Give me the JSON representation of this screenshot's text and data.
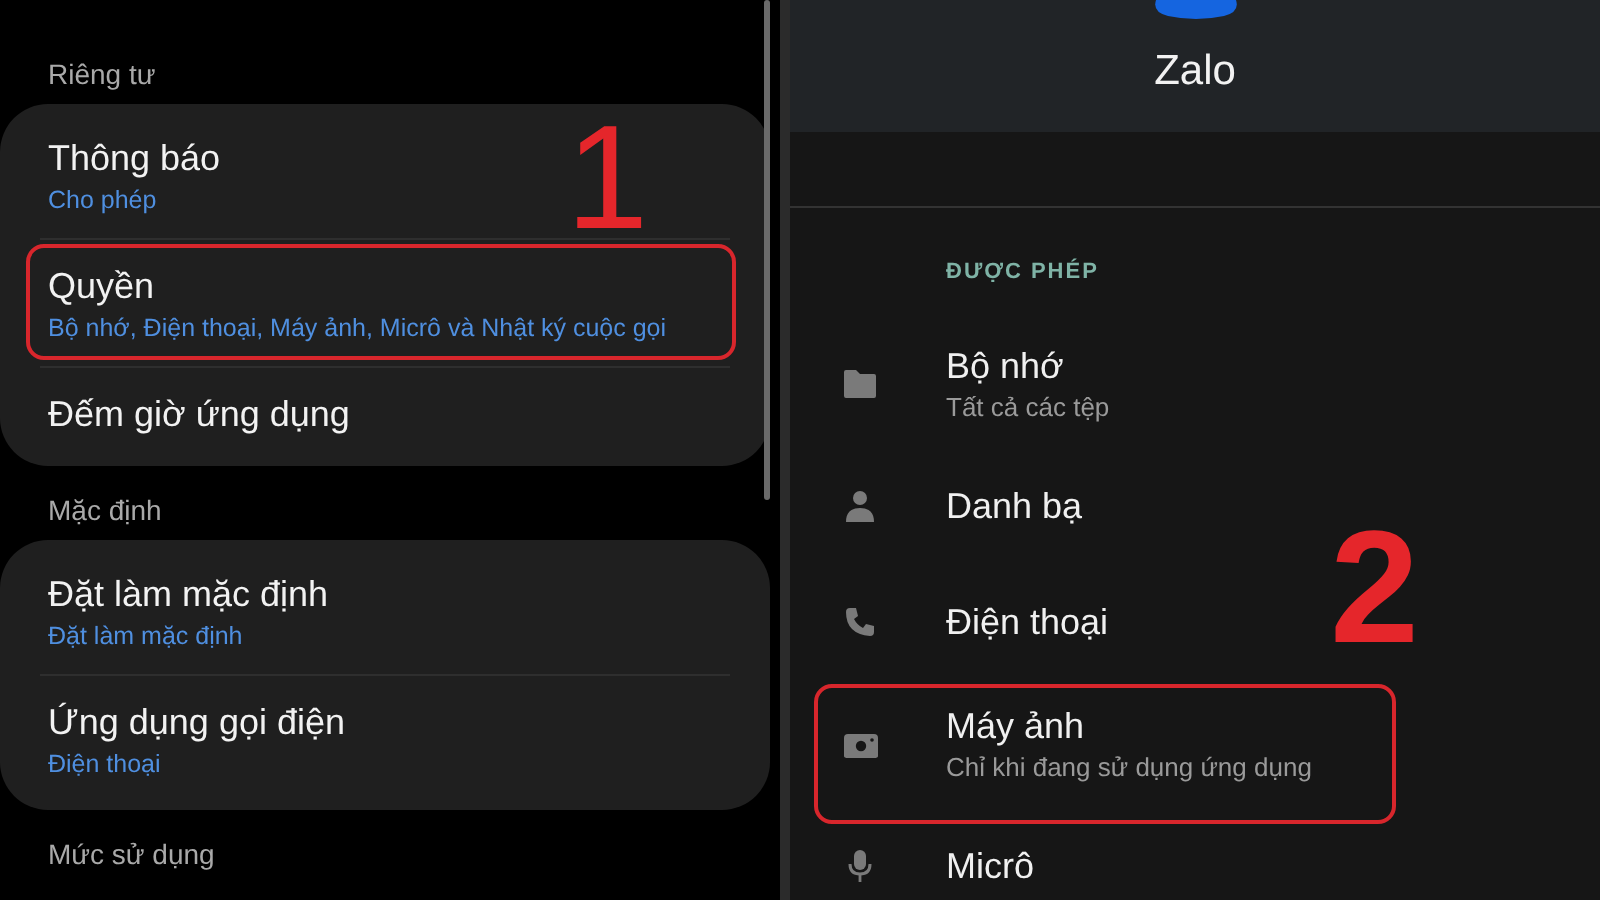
{
  "left_screen": {
    "step_number": "1",
    "sections": [
      {
        "header": "Riêng tư",
        "items": [
          {
            "title": "Thông báo",
            "subtitle": "Cho phép",
            "highlighted": false
          },
          {
            "title": "Quyền",
            "subtitle": "Bộ nhớ, Điện thoại, Máy ảnh, Micrô và Nhật ký cuộc gọi",
            "highlighted": true
          },
          {
            "title": "Đếm giờ ứng dụng",
            "highlighted": false
          }
        ]
      },
      {
        "header": "Mặc định",
        "items": [
          {
            "title": "Đặt làm mặc định",
            "subtitle": "Đặt làm mặc định",
            "highlighted": false
          },
          {
            "title": "Ứng dụng gọi điện",
            "subtitle": "Điện thoại",
            "highlighted": false
          }
        ]
      },
      {
        "header": "Mức sử dụng"
      }
    ]
  },
  "right_screen": {
    "app_name": "Zalo",
    "step_number": "2",
    "group_header": "ĐƯỢC PHÉP",
    "permissions": [
      {
        "kind": "folder",
        "title": "Bộ nhớ",
        "subtitle": "Tất cả các tệp",
        "highlighted": false
      },
      {
        "kind": "person",
        "title": "Danh bạ",
        "highlighted": false
      },
      {
        "kind": "phone",
        "title": "Điện thoại",
        "highlighted": false
      },
      {
        "kind": "camera",
        "title": "Máy ảnh",
        "subtitle": "Chỉ khi đang sử dụng ứng dụng",
        "highlighted": true
      },
      {
        "kind": "mic",
        "title": "Micrô",
        "highlighted": false
      }
    ]
  }
}
